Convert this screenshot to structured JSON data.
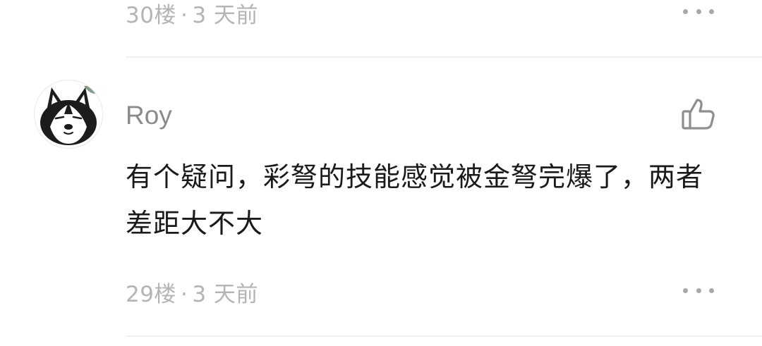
{
  "previous_comment": {
    "floor": "30楼",
    "separator": "·",
    "time": "3 天前"
  },
  "comment": {
    "avatar_icon": "husky-dog-avatar",
    "username": "Roy",
    "text": "有个疑问，彩弩的技能感觉被金弩完爆了，两者差距大不大",
    "floor": "29楼",
    "separator": "·",
    "time": "3 天前"
  },
  "icons": {
    "like": "thumbs-up-icon",
    "more": "more-horizontal-icon"
  },
  "colors": {
    "meta_text": "#b4b4b4",
    "username": "#8a8a8a",
    "body_text": "#1a1a1a",
    "divider": "#f0f0f0"
  }
}
